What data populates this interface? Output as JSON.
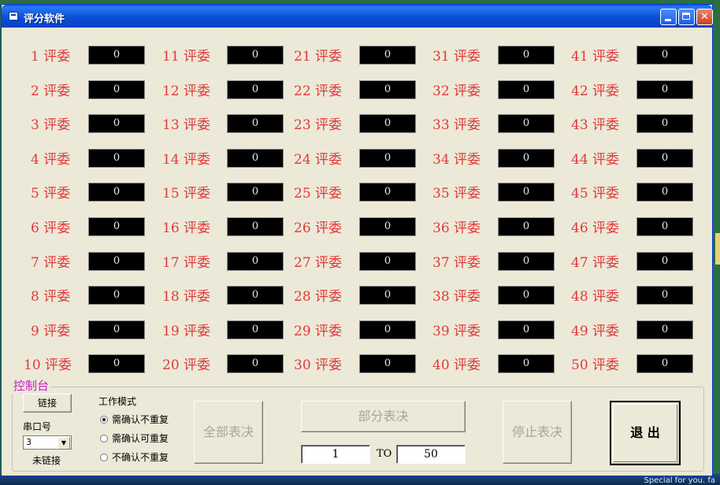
{
  "window": {
    "title": "评分软件"
  },
  "judges": [
    {
      "label": "1 评委",
      "score": "0"
    },
    {
      "label": "2 评委",
      "score": "0"
    },
    {
      "label": "3 评委",
      "score": "0"
    },
    {
      "label": "4 评委",
      "score": "0"
    },
    {
      "label": "5 评委",
      "score": "0"
    },
    {
      "label": "6 评委",
      "score": "0"
    },
    {
      "label": "7 评委",
      "score": "0"
    },
    {
      "label": "8 评委",
      "score": "0"
    },
    {
      "label": "9 评委",
      "score": "0"
    },
    {
      "label": "10 评委",
      "score": "0"
    },
    {
      "label": "11 评委",
      "score": "0"
    },
    {
      "label": "12 评委",
      "score": "0"
    },
    {
      "label": "13 评委",
      "score": "0"
    },
    {
      "label": "14 评委",
      "score": "0"
    },
    {
      "label": "15 评委",
      "score": "0"
    },
    {
      "label": "16 评委",
      "score": "0"
    },
    {
      "label": "17 评委",
      "score": "0"
    },
    {
      "label": "18 评委",
      "score": "0"
    },
    {
      "label": "19 评委",
      "score": "0"
    },
    {
      "label": "20 评委",
      "score": "0"
    },
    {
      "label": "21 评委",
      "score": "0"
    },
    {
      "label": "22 评委",
      "score": "0"
    },
    {
      "label": "23 评委",
      "score": "0"
    },
    {
      "label": "24 评委",
      "score": "0"
    },
    {
      "label": "25 评委",
      "score": "0"
    },
    {
      "label": "26 评委",
      "score": "0"
    },
    {
      "label": "27 评委",
      "score": "0"
    },
    {
      "label": "28 评委",
      "score": "0"
    },
    {
      "label": "29 评委",
      "score": "0"
    },
    {
      "label": "30 评委",
      "score": "0"
    },
    {
      "label": "31 评委",
      "score": "0"
    },
    {
      "label": "32 评委",
      "score": "0"
    },
    {
      "label": "33 评委",
      "score": "0"
    },
    {
      "label": "34 评委",
      "score": "0"
    },
    {
      "label": "35 评委",
      "score": "0"
    },
    {
      "label": "36 评委",
      "score": "0"
    },
    {
      "label": "37 评委",
      "score": "0"
    },
    {
      "label": "38 评委",
      "score": "0"
    },
    {
      "label": "39 评委",
      "score": "0"
    },
    {
      "label": "40 评委",
      "score": "0"
    },
    {
      "label": "41 评委",
      "score": "0"
    },
    {
      "label": "42 评委",
      "score": "0"
    },
    {
      "label": "43 评委",
      "score": "0"
    },
    {
      "label": "44 评委",
      "score": "0"
    },
    {
      "label": "45 评委",
      "score": "0"
    },
    {
      "label": "46 评委",
      "score": "0"
    },
    {
      "label": "47 评委",
      "score": "0"
    },
    {
      "label": "48 评委",
      "score": "0"
    },
    {
      "label": "49 评委",
      "score": "0"
    },
    {
      "label": "50 评委",
      "score": "0"
    }
  ],
  "console": {
    "title": "控制台",
    "connect_button": "链接",
    "port_label": "串口号",
    "port_value": "3",
    "status": "未链接",
    "mode_label": "工作模式",
    "modes": [
      {
        "label": "需确认不重复",
        "checked": true
      },
      {
        "label": "需确认可重复",
        "checked": false
      },
      {
        "label": "不确认不重复",
        "checked": false
      }
    ],
    "vote_all": "全部表决",
    "vote_part": "部分表决",
    "range_from": "1",
    "range_to_label": "TO",
    "range_to": "50",
    "stop_vote": "停止表决",
    "exit": "退 出"
  },
  "desktop_strip_text": "Special for you. fa"
}
